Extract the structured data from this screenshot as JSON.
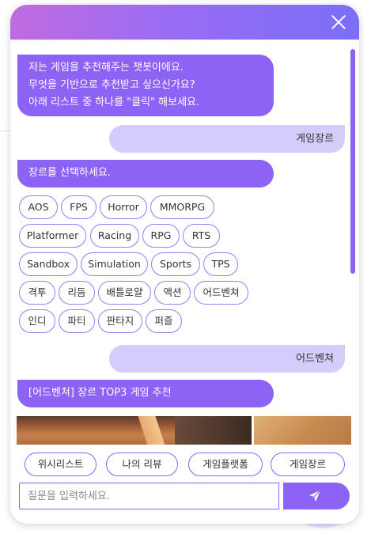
{
  "colors": {
    "accent": "#8d63f5",
    "user_bubble": "#d5ccfb",
    "header_start": "#c06bdf",
    "header_end": "#7b6ef8"
  },
  "header": {
    "close_icon": "close-icon"
  },
  "messages": {
    "intro": [
      "저는 게임을 추천해주는 챗봇이에요.",
      "무엇을 기반으로 추천받고 싶으신가요?",
      "아래 리스트 중 하나를 \"클릭\" 해보세요."
    ],
    "user_genre": "게임장르",
    "genre_prompt": "장르를 선택하세요.",
    "genres": [
      "AOS",
      "FPS",
      "Horror",
      "MMORPG",
      "Platformer",
      "Racing",
      "RPG",
      "RTS",
      "Sandbox",
      "Simulation",
      "Sports",
      "TPS",
      "격투",
      "리듬",
      "배틀로얄",
      "액션",
      "어드벤쳐",
      "인디",
      "파티",
      "판타지",
      "퍼즐"
    ],
    "user_choice": "어드벤쳐",
    "result_title": "[어드벤쳐] 장르 TOP3 게임 추천"
  },
  "quick_buttons": [
    "위시리스트",
    "나의 리뷰",
    "게임플랫폼",
    "게임장르"
  ],
  "input": {
    "placeholder": "질문을 입력하세요.",
    "value": ""
  },
  "send_icon": "send-icon"
}
